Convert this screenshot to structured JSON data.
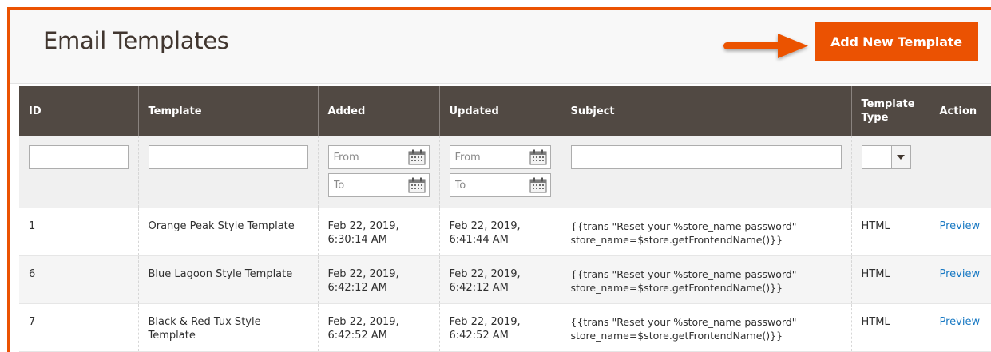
{
  "header": {
    "title": "Email Templates",
    "add_button_label": "Add New Template"
  },
  "colors": {
    "accent": "#eb5202",
    "table_header_bg": "#514943",
    "link": "#1979c3"
  },
  "icons": {
    "arrow": "arrow-right-icon",
    "calendar": "calendar-icon",
    "select": "chevron-down-icon"
  },
  "columns": [
    "ID",
    "Template",
    "Added",
    "Updated",
    "Subject",
    "Template Type",
    "Action"
  ],
  "filters": {
    "added_from_placeholder": "From",
    "added_to_placeholder": "To",
    "updated_from_placeholder": "From",
    "updated_to_placeholder": "To"
  },
  "rows": [
    {
      "id": "1",
      "template": "Orange Peak Style Template",
      "added": "Feb 22, 2019, 6:30:14 AM",
      "updated": "Feb 22, 2019, 6:41:44 AM",
      "subject": "{{trans \"Reset your %store_name password\" store_name=$store.getFrontendName()}}",
      "type": "HTML",
      "action": "Preview"
    },
    {
      "id": "6",
      "template": "Blue Lagoon Style Template",
      "added": "Feb 22, 2019, 6:42:12 AM",
      "updated": "Feb 22, 2019, 6:42:12 AM",
      "subject": "{{trans \"Reset your %store_name password\" store_name=$store.getFrontendName()}}",
      "type": "HTML",
      "action": "Preview"
    },
    {
      "id": "7",
      "template": "Black & Red Tux Style Template",
      "added": "Feb 22, 2019, 6:42:52 AM",
      "updated": "Feb 22, 2019, 6:42:52 AM",
      "subject": "{{trans \"Reset your %store_name password\" store_name=$store.getFrontendName()}}",
      "type": "HTML",
      "action": "Preview"
    }
  ]
}
